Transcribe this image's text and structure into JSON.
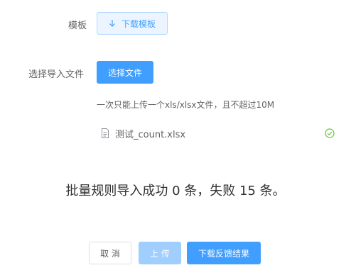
{
  "form": {
    "template_label": "模板",
    "download_template_label": "下载模板",
    "select_file_label": "选择导入文件",
    "select_file_button": "选择文件",
    "tip": "一次只能上传一个xls/xlsx文件，且不超过10M",
    "file": {
      "name": "测试_count.xlsx",
      "status": "success"
    }
  },
  "result": {
    "message": "批量规则导入成功 0 条，失败 15 条。"
  },
  "footer": {
    "cancel_label": "取 消",
    "upload_label": "上 传",
    "download_feedback_label": "下载反馈结果"
  },
  "colors": {
    "primary": "#409eff",
    "primary_light": "#ecf5ff",
    "disabled_primary": "#a0cfff",
    "success": "#67c23a"
  },
  "icons": {
    "download": "arrow-down-icon",
    "file": "document-icon",
    "success": "circle-check-icon"
  }
}
